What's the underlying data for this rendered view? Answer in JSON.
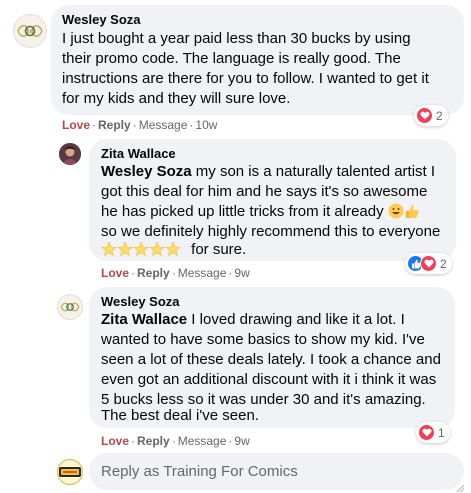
{
  "comments": [
    {
      "author": "Wesley Soza",
      "lines": [
        "I just bought a year paid less than 30 bucks by using",
        "their promo code. The language is really good. The",
        "instructions are there for you to follow. I wanted to get it",
        "for my kids and they will sure love."
      ],
      "actions": {
        "like": "Love",
        "reply": "Reply",
        "message": "Message",
        "time": "10w"
      },
      "reaction_count": "2",
      "avatar_icon": "gucci-style-logo-icon"
    },
    {
      "author": "Zita Wallace",
      "mention": "Wesley Soza",
      "line1_rest": " my son is a naturally talented artist I",
      "lines": [
        "got this deal for him and he says it's so awesome",
        "he has picked up little tricks from it already",
        "so we definitely highly recommend this to everyone",
        "for sure."
      ],
      "actions": {
        "like": "Love",
        "reply": "Reply",
        "message": "Message",
        "time": "9w"
      },
      "reaction_count": "2",
      "avatar_icon": "user-photo-avatar"
    },
    {
      "author": "Wesley Soza",
      "mention": "Zita Wallace",
      "line1_rest": " I loved drawing and like it a lot. I",
      "lines": [
        "wanted to have some basics to show my kid. I've",
        "seen a lot of these deals lately. I took a chance and",
        "even got an additional discount with it i think it was",
        "5 bucks less so it was under 30 and it's amazing.",
        "The best deal i've seen."
      ],
      "actions": {
        "like": "Love",
        "reply": "Reply",
        "message": "Message",
        "time": "9w"
      },
      "reaction_count": "1",
      "avatar_icon": "gucci-style-logo-icon"
    }
  ],
  "reply": {
    "placeholder": "Reply as Training For Comics",
    "avatar_icon": "training-for-comics-logo-icon"
  },
  "colors": {
    "bubble": "#f0f2f5",
    "secondary_text": "#65676b",
    "love_text": "#b04a4a",
    "heart": "#f33e58",
    "like": "#1877f2"
  }
}
